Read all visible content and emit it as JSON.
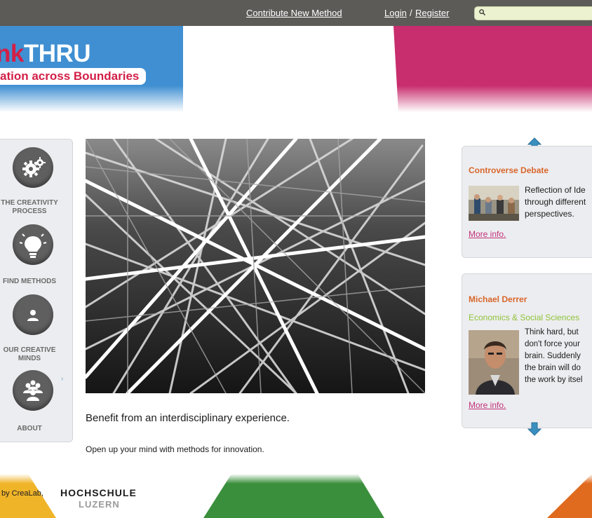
{
  "topbar": {
    "contribute": "Contribute New Method",
    "login": "Login",
    "separator": "/",
    "register": "Register",
    "search_placeholder": ""
  },
  "logo": {
    "title_part1": "nk",
    "title_part2": "THRU",
    "tagline": "ation across Boundaries"
  },
  "nav": {
    "items": [
      {
        "label": "THE CREATIVITY PROCESS",
        "icon": "gears-icon"
      },
      {
        "label": "FIND METHODS",
        "icon": "lightbulb-icon"
      },
      {
        "label": "OUR CREATIVE MINDS",
        "icon": "person-icon"
      },
      {
        "label": "ABOUT",
        "icon": "people-icon"
      }
    ],
    "expand_glyph": "›"
  },
  "main": {
    "headline": "Benefit from an interdisciplinary experience.",
    "subline": "Open up your mind with methods for innovation."
  },
  "panels": {
    "method": {
      "title": "Controverse Debate",
      "desc_lines": [
        "Reflection of Ide",
        "through different",
        "perspectives."
      ],
      "more": "More info."
    },
    "person": {
      "name": "Michael Derrer",
      "field": "Economics & Social Sciences",
      "quote_lines": [
        "Think hard, but",
        "don't force your",
        "brain. Suddenly",
        "the brain will do",
        "the work by itsel"
      ],
      "more": "More info."
    }
  },
  "footer": {
    "credit": "by CreaLab,",
    "school1": "HOCHSCHULE",
    "school2": "LUZERN"
  },
  "colors": {
    "topbar": "#5c5b58",
    "blue": "#3f8fd2",
    "magenta": "#c82d6d",
    "green": "#3a8f3c",
    "orange": "#e06a1e",
    "yellow": "#f0b429",
    "accent_orange": "#d9662b",
    "link_pink": "#c23079",
    "field_green": "#8fc33a"
  }
}
